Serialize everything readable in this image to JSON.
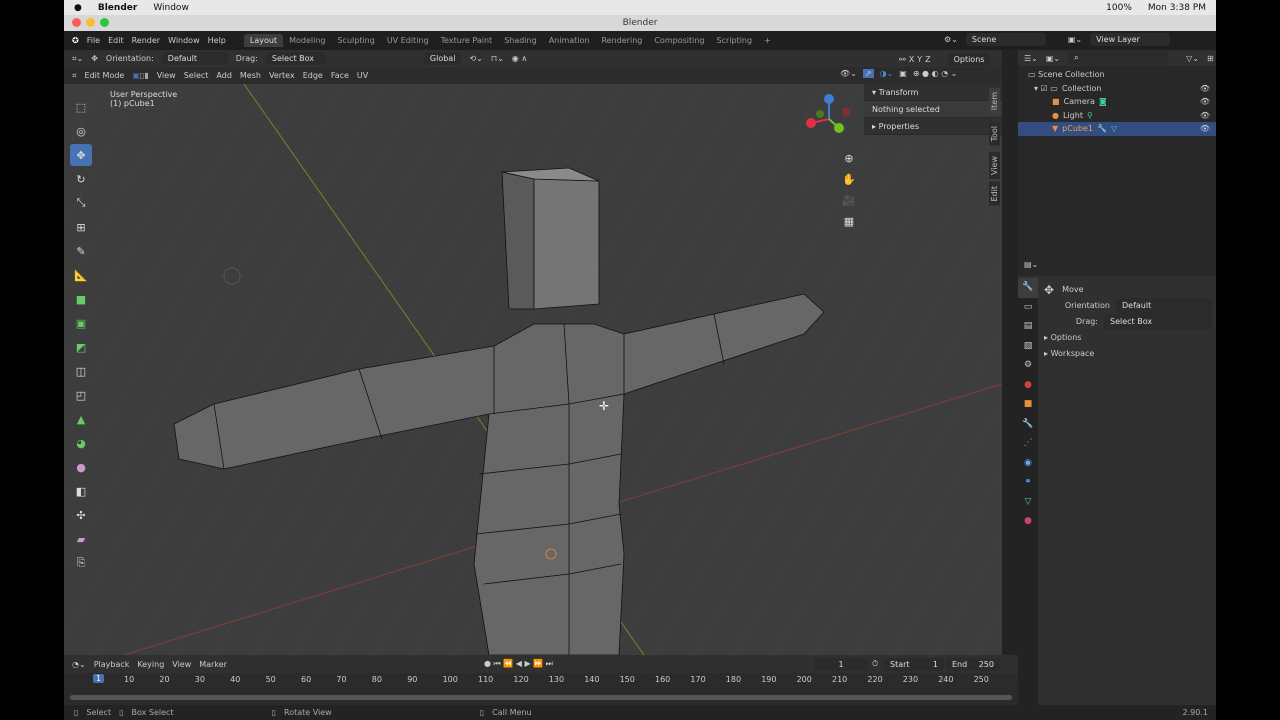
{
  "macos": {
    "app": "Blender",
    "menu": "Window",
    "battery": "100%",
    "clock": "Mon 3:38 PM"
  },
  "window_title": "Blender",
  "menus": [
    "File",
    "Edit",
    "Render",
    "Window",
    "Help"
  ],
  "workspaces": [
    "Layout",
    "Modeling",
    "Sculpting",
    "UV Editing",
    "Texture Paint",
    "Shading",
    "Animation",
    "Rendering",
    "Compositing",
    "Scripting",
    "+"
  ],
  "scene": "Scene",
  "view_layer": "View Layer",
  "tool_header": {
    "orientation_label": "Orientation:",
    "orientation": "Default",
    "drag_label": "Drag:",
    "drag": "Select Box",
    "transform": "Global",
    "axes": [
      "X",
      "Y",
      "Z"
    ],
    "options": "Options"
  },
  "edit_header": {
    "mode": "Edit Mode",
    "menus": [
      "View",
      "Select",
      "Add",
      "Mesh",
      "Vertex",
      "Edge",
      "Face",
      "UV"
    ]
  },
  "viewport": {
    "perspective": "User Perspective",
    "object": "(1) pCube1"
  },
  "npanel": {
    "transform": "Transform",
    "nothing": "Nothing selected",
    "properties": "Properties",
    "tabs": [
      "Item",
      "Tool",
      "View",
      "Edit"
    ]
  },
  "outliner": {
    "root": "Scene Collection",
    "items": [
      {
        "name": "Collection"
      },
      {
        "name": "Camera"
      },
      {
        "name": "Light"
      },
      {
        "name": "pCube1"
      }
    ]
  },
  "properties": {
    "tool": "Move",
    "orientation_label": "Orientation",
    "orientation": "Default",
    "drag_label": "Drag:",
    "drag": "Select Box",
    "sections": [
      "Options",
      "Workspace"
    ]
  },
  "timeline": {
    "menus": [
      "Playback",
      "Keying",
      "View",
      "Marker"
    ],
    "current": "1",
    "start_label": "Start",
    "start": "1",
    "end_label": "End",
    "end": "250",
    "ticks": [
      "10",
      "20",
      "30",
      "40",
      "50",
      "60",
      "70",
      "80",
      "90",
      "100",
      "110",
      "120",
      "130",
      "140",
      "150",
      "160",
      "170",
      "180",
      "190",
      "200",
      "210",
      "220",
      "230",
      "240",
      "250"
    ]
  },
  "status": {
    "select": "Select",
    "box_select": "Box Select",
    "rotate": "Rotate View",
    "call_menu": "Call Menu",
    "version": "2.90.1"
  }
}
